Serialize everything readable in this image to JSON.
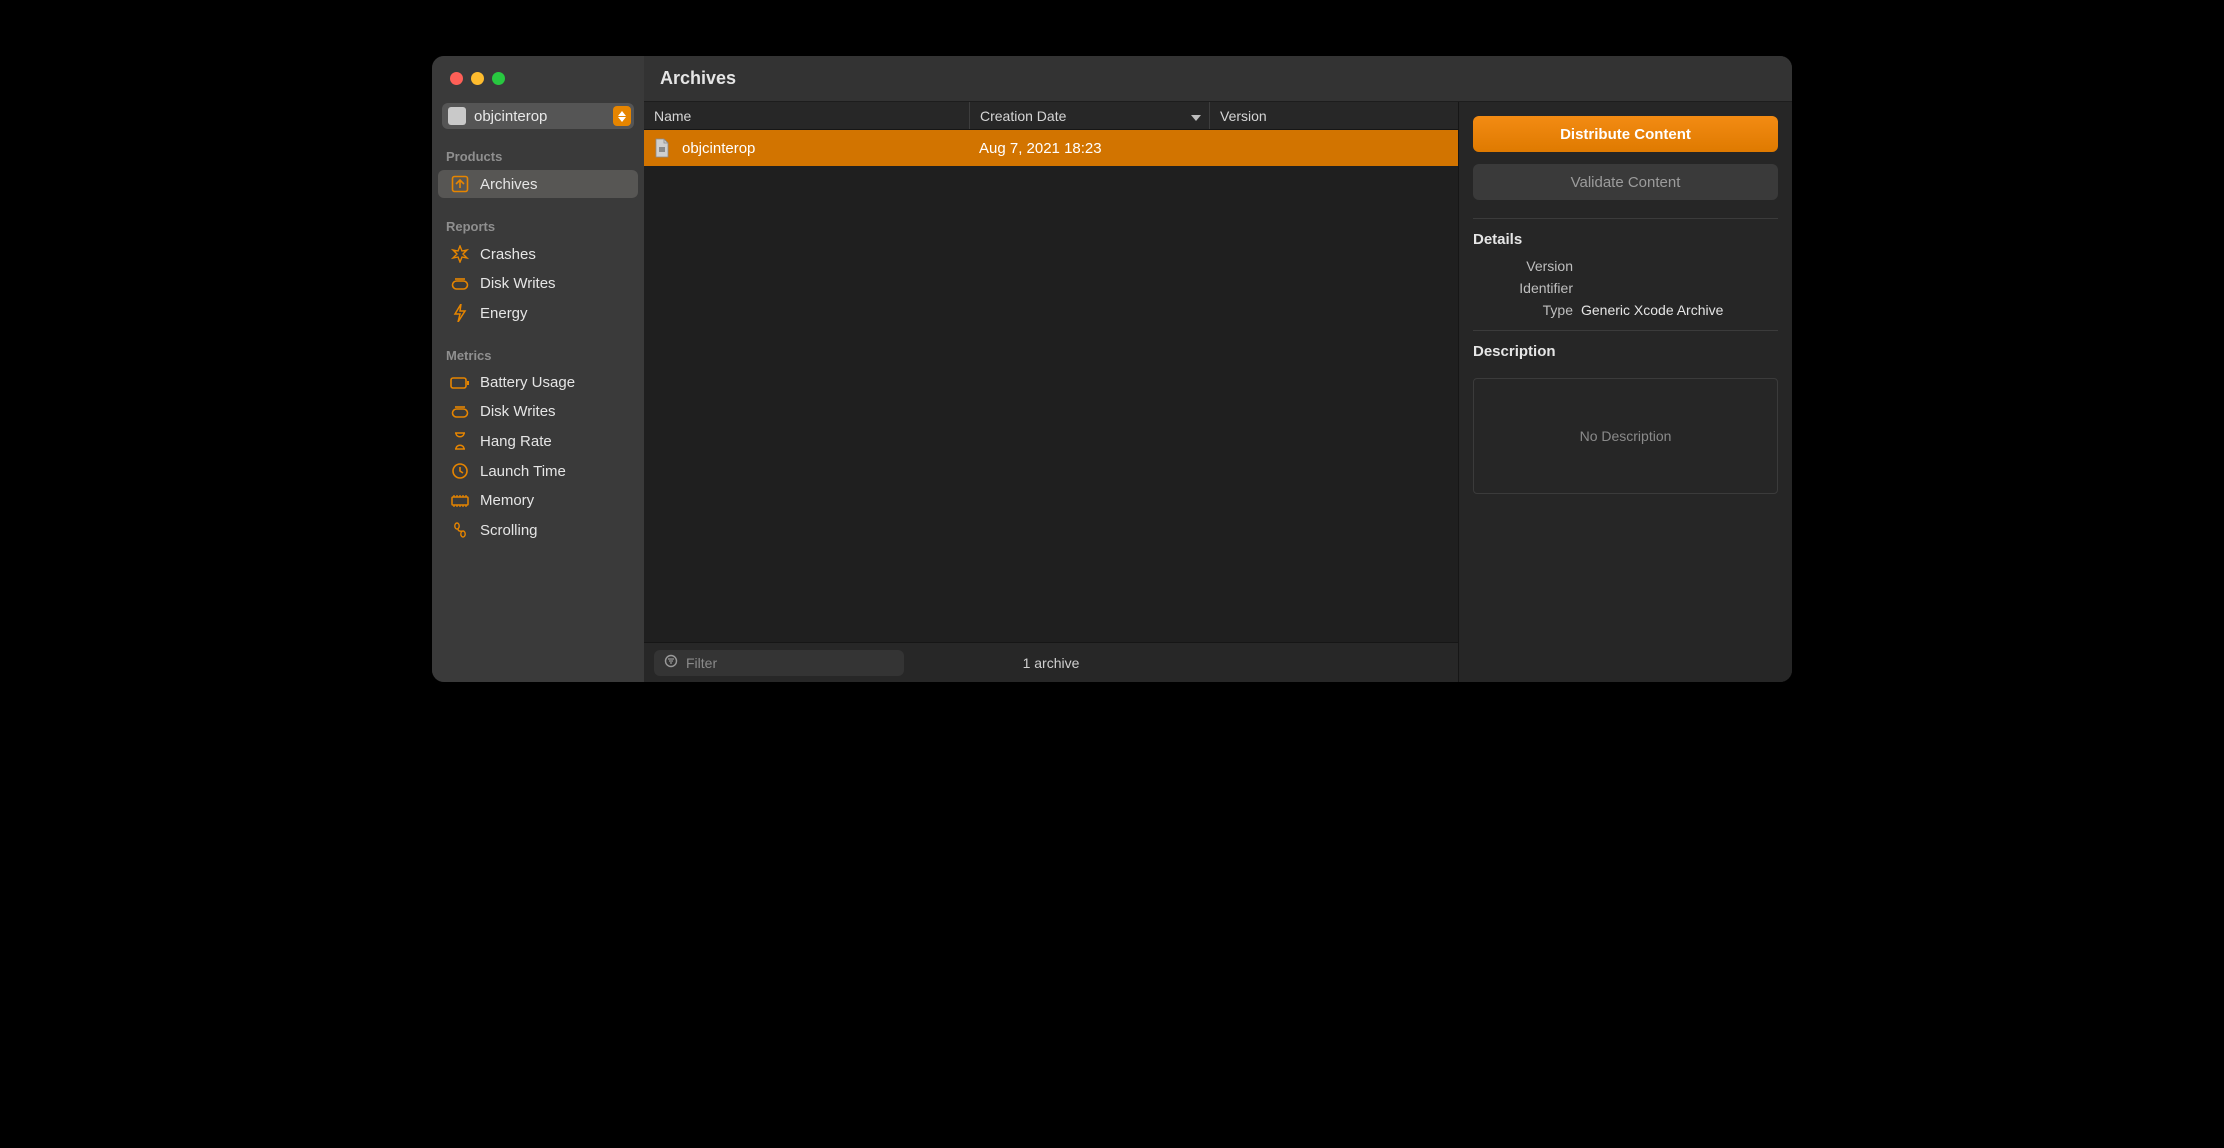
{
  "header": {
    "title": "Archives"
  },
  "product_selector": {
    "selected": "objcinterop"
  },
  "sidebar": {
    "sections": [
      {
        "header": "Products",
        "items": [
          {
            "label": "Archives",
            "icon": "archive-icon",
            "selected": true
          }
        ]
      },
      {
        "header": "Reports",
        "items": [
          {
            "label": "Crashes",
            "icon": "crash-icon"
          },
          {
            "label": "Disk Writes",
            "icon": "disk-icon"
          },
          {
            "label": "Energy",
            "icon": "bolt-icon"
          }
        ]
      },
      {
        "header": "Metrics",
        "items": [
          {
            "label": "Battery Usage",
            "icon": "battery-icon"
          },
          {
            "label": "Disk Writes",
            "icon": "disk-icon"
          },
          {
            "label": "Hang Rate",
            "icon": "hourglass-icon"
          },
          {
            "label": "Launch Time",
            "icon": "clock-icon"
          },
          {
            "label": "Memory",
            "icon": "memory-icon"
          },
          {
            "label": "Scrolling",
            "icon": "scroll-icon"
          }
        ]
      }
    ]
  },
  "table": {
    "columns": [
      {
        "key": "name",
        "label": "Name"
      },
      {
        "key": "creation_date",
        "label": "Creation Date",
        "sort": "desc"
      },
      {
        "key": "version",
        "label": "Version"
      }
    ],
    "rows": [
      {
        "name": "objcinterop",
        "creation_date": "Aug 7, 2021 18:23",
        "version": "",
        "selected": true
      }
    ]
  },
  "footer": {
    "filter_placeholder": "Filter",
    "count_label": "1 archive"
  },
  "actions": {
    "distribute_label": "Distribute Content",
    "validate_label": "Validate Content"
  },
  "details": {
    "header": "Details",
    "fields": [
      {
        "key": "Version",
        "value": ""
      },
      {
        "key": "Identifier",
        "value": ""
      },
      {
        "key": "Type",
        "value": "Generic Xcode Archive"
      }
    ],
    "description_header": "Description",
    "description_placeholder": "No Description"
  },
  "colors": {
    "accent": "#e68500",
    "row_selected": "#d27400"
  }
}
